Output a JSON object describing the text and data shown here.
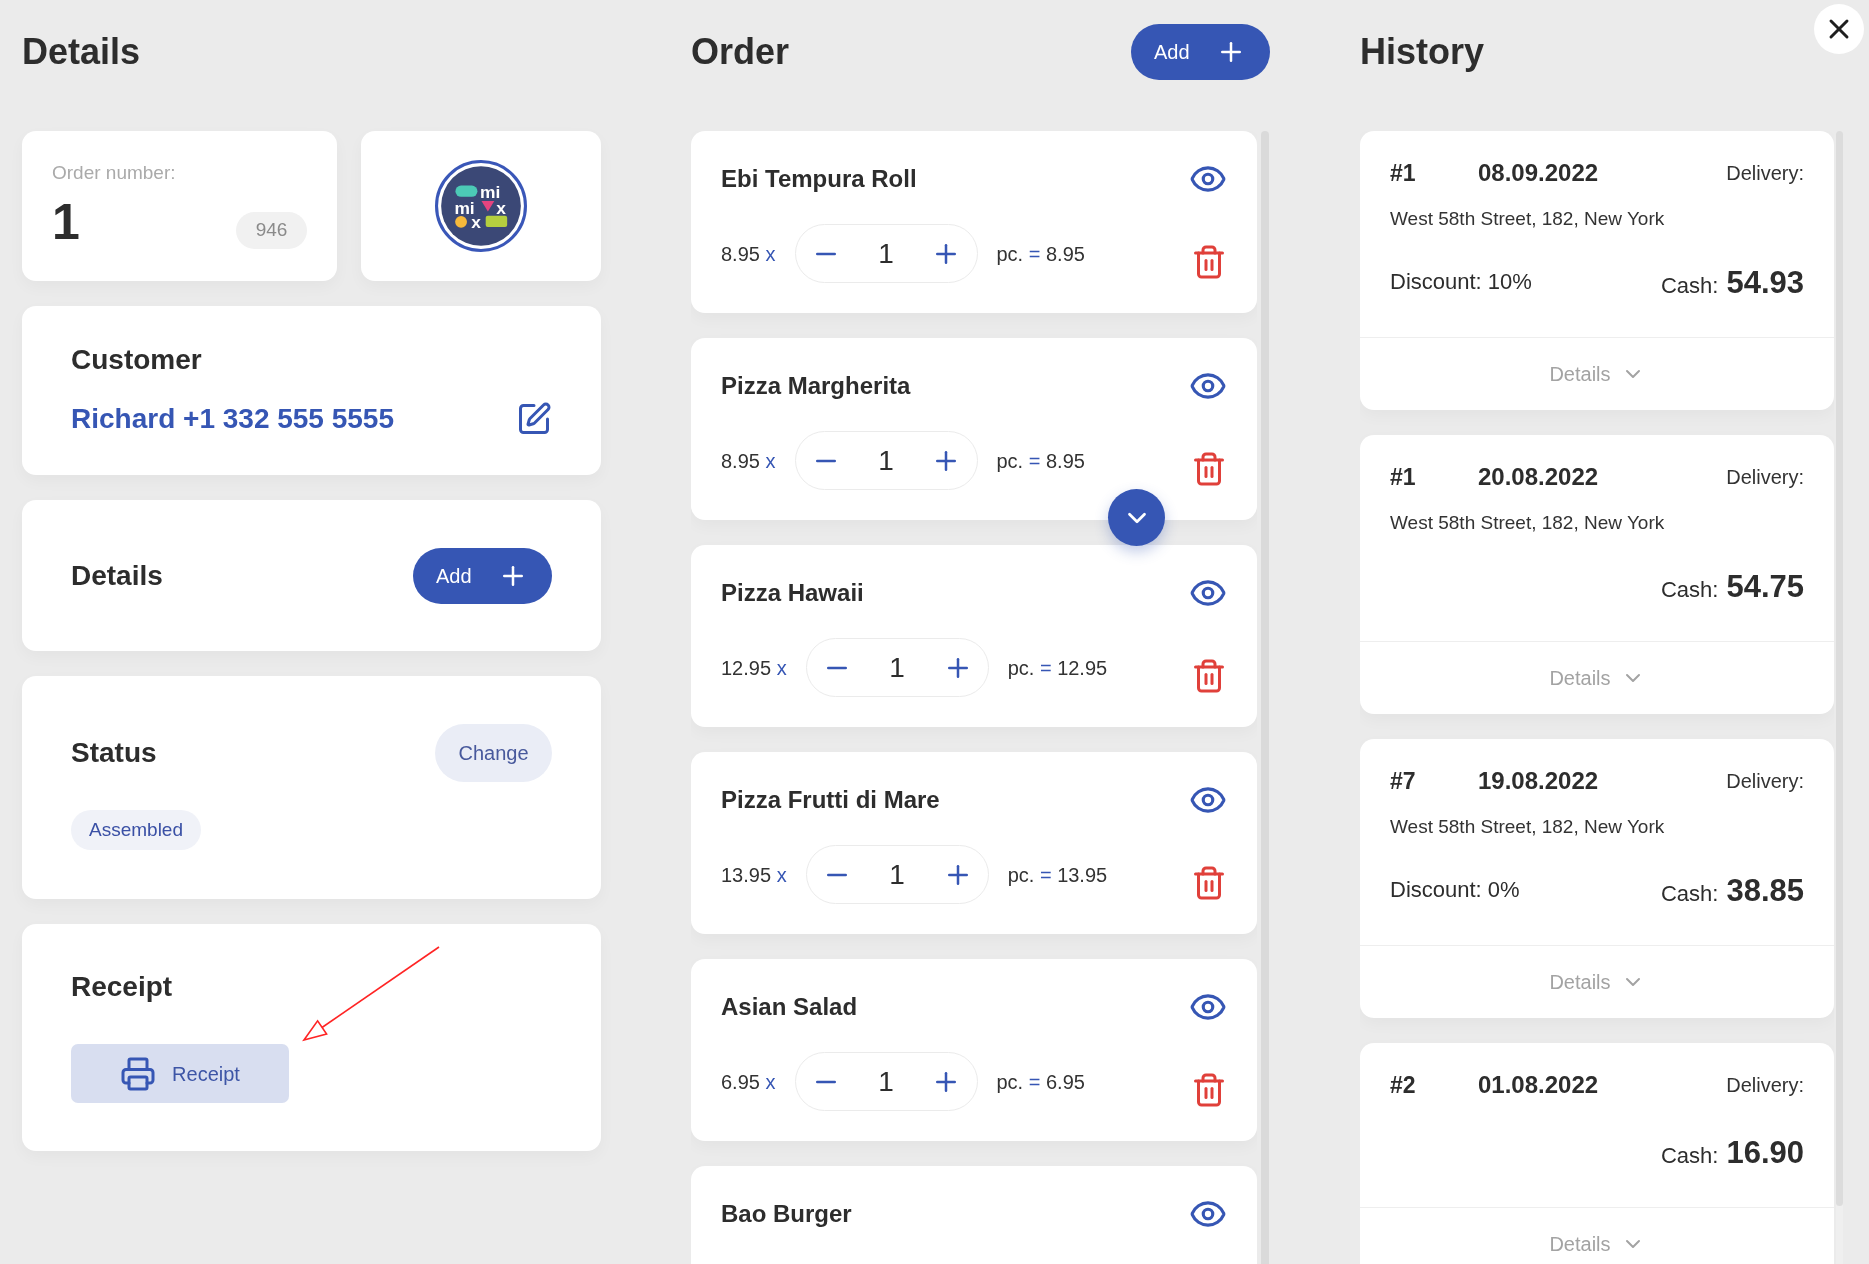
{
  "details": {
    "title": "Details",
    "order_number": {
      "label": "Order number:",
      "value": "1",
      "badge": "946"
    },
    "logo": {
      "marks": [
        "mi",
        "mi",
        "x",
        "x"
      ]
    },
    "customer": {
      "title": "Customer",
      "value": "Richard +1 332 555 5555"
    },
    "extras": {
      "title": "Details",
      "add_button": "Add"
    },
    "status": {
      "title": "Status",
      "change_button": "Change",
      "value": "Assembled"
    },
    "receipt": {
      "title": "Receipt",
      "button": "Receipt"
    }
  },
  "order": {
    "title": "Order",
    "add_button": "Add",
    "items": [
      {
        "name": "Ebi Tempura Roll",
        "price": "8.95",
        "times": "x",
        "quantity": "1",
        "unit": "pc.",
        "equals": "=",
        "total": "8.95"
      },
      {
        "name": "Pizza Margherita",
        "price": "8.95",
        "times": "x",
        "quantity": "1",
        "unit": "pc.",
        "equals": "=",
        "total": "8.95"
      },
      {
        "name": "Pizza Hawaii",
        "price": "12.95",
        "times": "x",
        "quantity": "1",
        "unit": "pc.",
        "equals": "=",
        "total": "12.95"
      },
      {
        "name": "Pizza Frutti di Mare",
        "price": "13.95",
        "times": "x",
        "quantity": "1",
        "unit": "pc.",
        "equals": "=",
        "total": "13.95"
      },
      {
        "name": "Asian Salad",
        "price": "6.95",
        "times": "x",
        "quantity": "1",
        "unit": "pc.",
        "equals": "=",
        "total": "6.95"
      },
      {
        "name": "Bao Burger"
      }
    ]
  },
  "history": {
    "title": "History",
    "entries": [
      {
        "number": "#1",
        "date": "08.09.2022",
        "type": "Delivery:",
        "address": "West 58th Street, 182, New York",
        "discount": "Discount: 10%",
        "cash_label": "Cash:",
        "cash": "54.93",
        "toggle": "Details"
      },
      {
        "number": "#1",
        "date": "20.08.2022",
        "type": "Delivery:",
        "address": "West 58th Street, 182, New York",
        "cash_label": "Cash:",
        "cash": "54.75",
        "toggle": "Details"
      },
      {
        "number": "#7",
        "date": "19.08.2022",
        "type": "Delivery:",
        "address": "West 58th Street, 182, New York",
        "discount": "Discount: 0%",
        "cash_label": "Cash:",
        "cash": "38.85",
        "toggle": "Details"
      },
      {
        "number": "#2",
        "date": "01.08.2022",
        "type": "Delivery:",
        "cash_label": "Cash:",
        "cash": "16.90",
        "toggle": "Details"
      }
    ]
  }
}
